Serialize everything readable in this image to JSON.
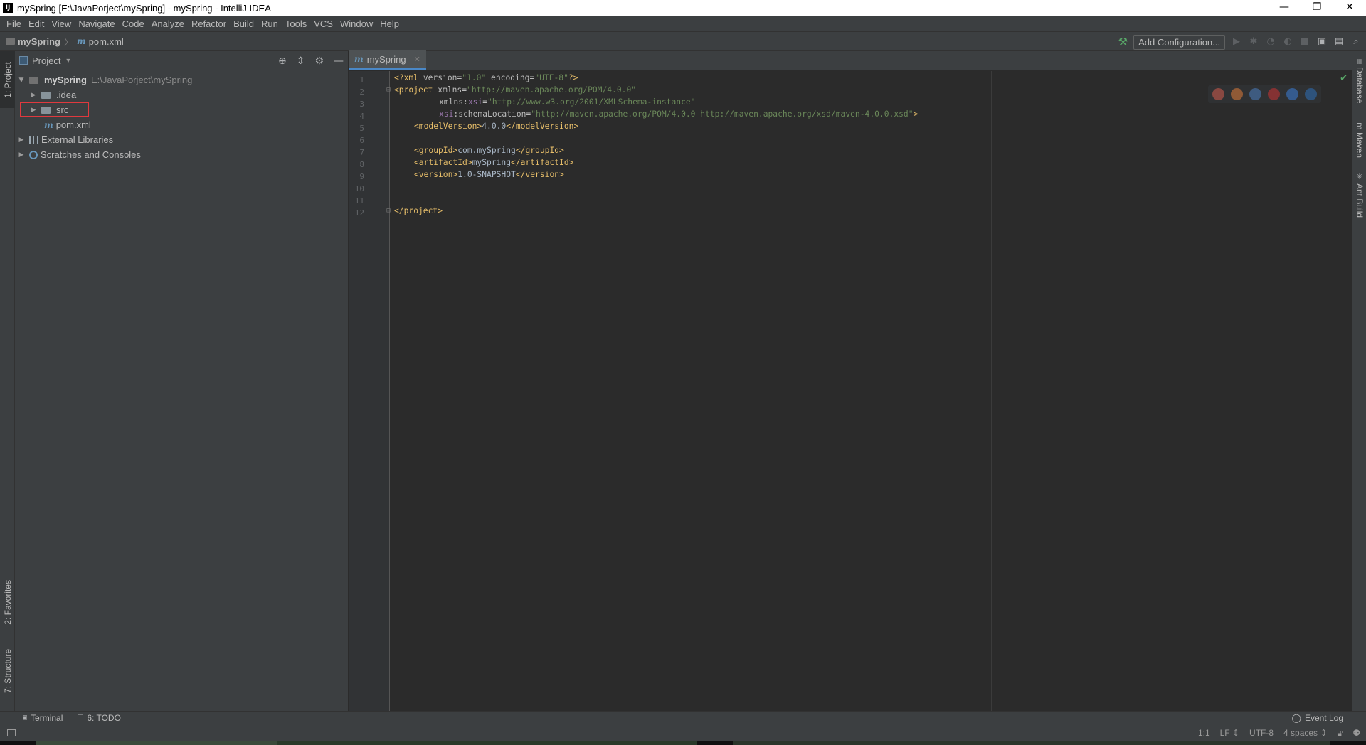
{
  "window": {
    "title": "mySpring [E:\\JavaPorject\\mySpring] - mySpring - IntelliJ IDEA",
    "app_icon_label": "IJ",
    "controls": [
      "—",
      "❐",
      "✕"
    ]
  },
  "menu": [
    "File",
    "Edit",
    "View",
    "Navigate",
    "Code",
    "Analyze",
    "Refactor",
    "Build",
    "Run",
    "Tools",
    "VCS",
    "Window",
    "Help"
  ],
  "navbar": {
    "project": "mySpring",
    "file": "pom.xml",
    "add_configuration": "Add Configuration..."
  },
  "left_tabs": {
    "project": "1: Project",
    "favorites": "2: Favorites",
    "structure": "7: Structure"
  },
  "project_panel": {
    "title": "Project",
    "tree": [
      {
        "label": "mySpring",
        "path": "E:\\JavaPorject\\mySpring"
      },
      {
        "label": ".idea"
      },
      {
        "label": "src"
      },
      {
        "label": "pom.xml"
      },
      {
        "label": "External Libraries"
      },
      {
        "label": "Scratches and Consoles"
      }
    ]
  },
  "editor": {
    "tab": "mySpring",
    "line_numbers": [
      "1",
      "2",
      "3",
      "4",
      "5",
      "6",
      "7",
      "8",
      "9",
      "10",
      "11",
      "12"
    ],
    "lines": {
      "l1_open": "<?xml ",
      "l1_attr": "version=",
      "l1_val": "\"1.0\"",
      "l1_attr2": " encoding=",
      "l1_val2": "\"UTF-8\"",
      "l1_close": "?>",
      "l2_tag": "<project ",
      "l2_attr": "xmlns=",
      "l2_val": "\"http://maven.apache.org/POM/4.0.0\"",
      "l3_attr": "xmlns:",
      "l3_ns": "xsi",
      "l3_eq": "=",
      "l3_val": "\"http://www.w3.org/2001/XMLSchema-instance\"",
      "l4_ns": "xsi",
      "l4_attr": ":schemaLocation=",
      "l4_val": "\"http://maven.apache.org/POM/4.0.0 http://maven.apache.org/xsd/maven-4.0.0.xsd\"",
      "l4_close": ">",
      "l5_open": "<modelVersion>",
      "l5_txt": "4.0.0",
      "l5_close": "</modelVersion>",
      "l7_open": "<groupId>",
      "l7_txt": "com.mySpring",
      "l7_close": "</groupId>",
      "l8_open": "<artifactId>",
      "l8_txt": "mySpring",
      "l8_close": "</artifactId>",
      "l9_open": "<version>",
      "l9_txt": "1.0-SNAPSHOT",
      "l9_close": "</version>",
      "l12": "</project>"
    }
  },
  "right_tabs": [
    "Database",
    "Maven",
    "Ant Build"
  ],
  "bottom_tools": {
    "terminal": "Terminal",
    "todo": "6: TODO",
    "event_log": "Event Log"
  },
  "status": {
    "position": "1:1",
    "line_sep": "LF ⇕",
    "encoding": "UTF-8",
    "indent": "4 spaces ⇕"
  },
  "colors": {
    "bg_editor": "#2b2b2b",
    "bg_panel": "#3c3f41",
    "xml_tag": "#e8bf6a",
    "xml_value": "#6a8759",
    "xml_namespace": "#9876aa",
    "highlight_box": "#e0393e"
  }
}
